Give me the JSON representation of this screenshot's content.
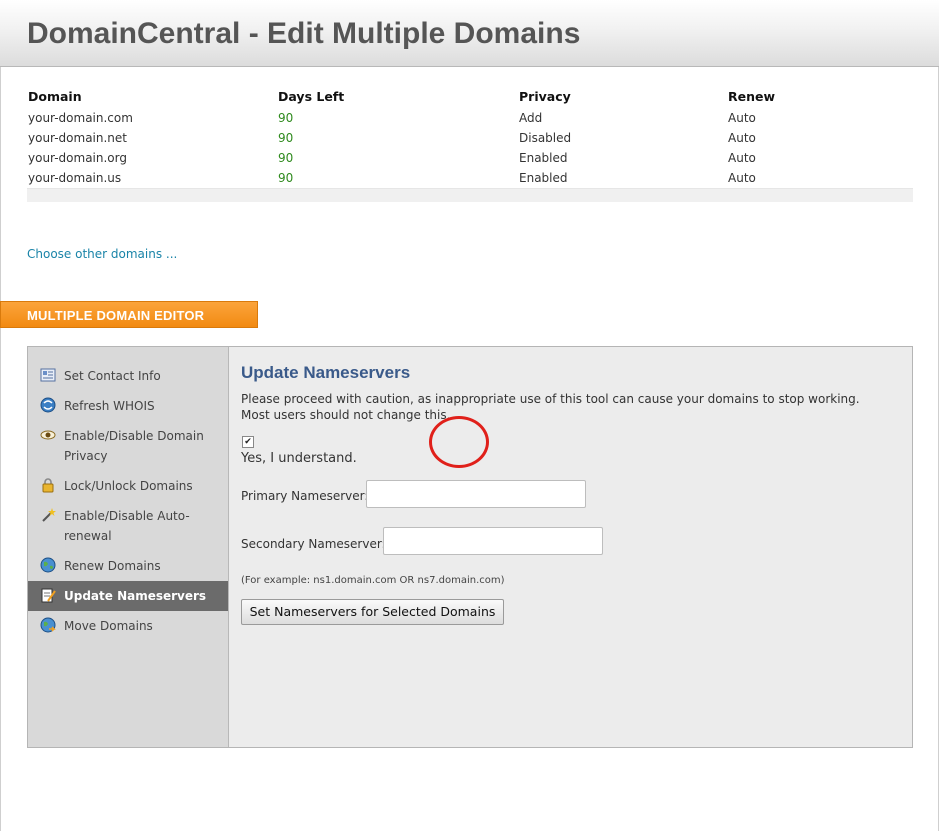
{
  "header": {
    "title": "DomainCentral - Edit Multiple Domains"
  },
  "domain_table": {
    "columns": [
      "Domain",
      "Days Left",
      "Privacy",
      "Renew"
    ],
    "rows": [
      {
        "domain": "your-domain.com",
        "days_left": "90",
        "privacy": "Add",
        "renew": "Auto"
      },
      {
        "domain": "your-domain.net",
        "days_left": "90",
        "privacy": "Disabled",
        "renew": "Auto"
      },
      {
        "domain": "your-domain.org",
        "days_left": "90",
        "privacy": "Enabled",
        "renew": "Auto"
      },
      {
        "domain": "your-domain.us",
        "days_left": "90",
        "privacy": "Enabled",
        "renew": "Auto"
      }
    ]
  },
  "choose_link": "Choose other domains ...",
  "section_tab": "MULTIPLE DOMAIN EDITOR",
  "sidebar": {
    "items": [
      {
        "label": "Set Contact Info",
        "icon": "contact-card-icon"
      },
      {
        "label": "Refresh WHOIS",
        "icon": "refresh-globe-icon"
      },
      {
        "label": "Enable/Disable Domain Privacy",
        "icon": "eye-icon"
      },
      {
        "label": "Lock/Unlock Domains",
        "icon": "padlock-icon"
      },
      {
        "label": "Enable/Disable Auto-renewal",
        "icon": "wand-icon"
      },
      {
        "label": "Renew Domains",
        "icon": "globe-icon"
      },
      {
        "label": "Update Nameservers",
        "icon": "notepad-pencil-icon"
      },
      {
        "label": "Move Domains",
        "icon": "globe-arrow-icon"
      }
    ],
    "active_index": 6
  },
  "main": {
    "title": "Update Nameservers",
    "warning": "Please proceed with caution, as inappropriate use of this tool can cause your domains to stop working. Most users should not change this.",
    "checkbox_checked": true,
    "checkbox_label": "Yes, I understand.",
    "primary_label": "Primary Nameserver:",
    "primary_value": "",
    "secondary_label": "Secondary Nameserver:",
    "secondary_value": "",
    "example": "(For example: ns1.domain.com OR ns7.domain.com)",
    "submit_label": "Set Nameservers for Selected Domains"
  },
  "colors": {
    "accent_orange": "#f28a12",
    "title_blue": "#3a5a8a",
    "link_blue": "#1a84a8",
    "days_green": "#2f8a1e",
    "annotation_red": "#e0201a"
  }
}
